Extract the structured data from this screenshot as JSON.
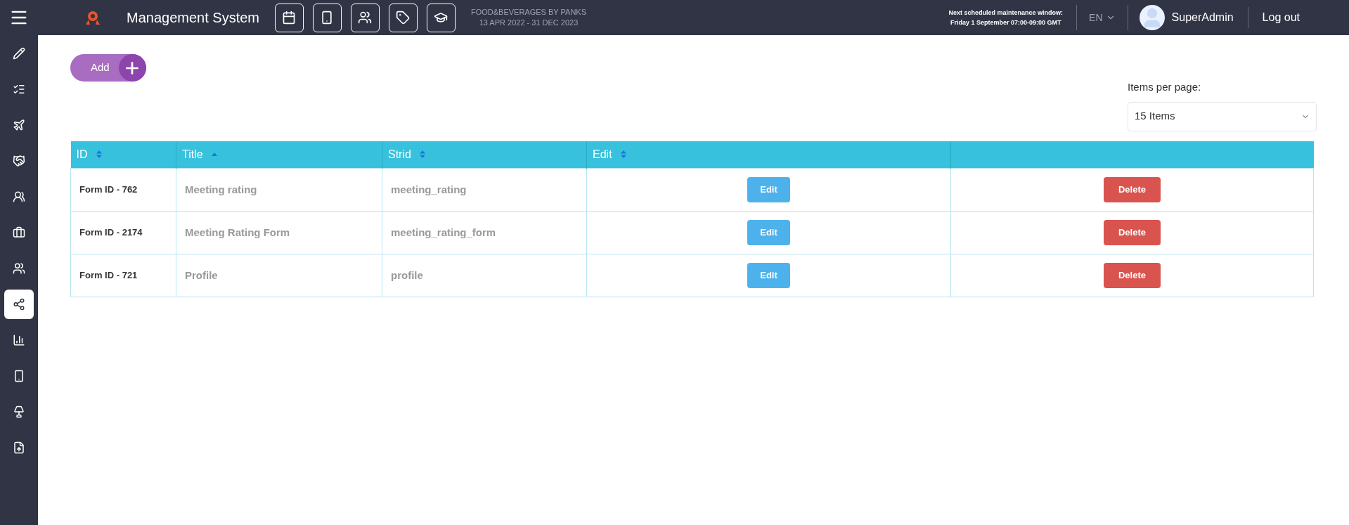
{
  "header": {
    "title": "Management System",
    "event_name": "FOOD&BEVERAGES BY PANKS",
    "event_dates": "13 APR 2022 - 31 DEC 2023",
    "maintenance_label": "Next scheduled maintenance window:",
    "maintenance_time": "Friday 1 September 07:00-09:00 GMT",
    "language": "EN",
    "user": "SuperAdmin",
    "logout": "Log out"
  },
  "sidebar": {
    "items": [
      {
        "selected": false
      },
      {
        "selected": false
      },
      {
        "selected": false
      },
      {
        "selected": false
      },
      {
        "selected": false
      },
      {
        "selected": false
      },
      {
        "selected": false
      },
      {
        "selected": true
      },
      {
        "selected": false
      },
      {
        "selected": false
      },
      {
        "selected": false
      },
      {
        "selected": false
      }
    ]
  },
  "add_button": "Add",
  "items_per_page": {
    "label": "Items per page:",
    "value": "15 Items"
  },
  "table": {
    "columns": [
      {
        "label": "ID",
        "sorted": false
      },
      {
        "label": "Title",
        "sorted": true
      },
      {
        "label": "Strid",
        "sorted": false
      },
      {
        "label": "Edit",
        "sorted": false
      }
    ],
    "rows": [
      {
        "id": "Form ID - 762",
        "title": "Meeting rating",
        "strid": "meeting_rating",
        "edit": "Edit",
        "delete": "Delete"
      },
      {
        "id": "Form ID - 2174",
        "title": "Meeting Rating Form",
        "strid": "meeting_rating_form",
        "edit": "Edit",
        "delete": "Delete"
      },
      {
        "id": "Form ID - 721",
        "title": "Profile",
        "strid": "profile",
        "edit": "Edit",
        "delete": "Delete"
      }
    ]
  }
}
